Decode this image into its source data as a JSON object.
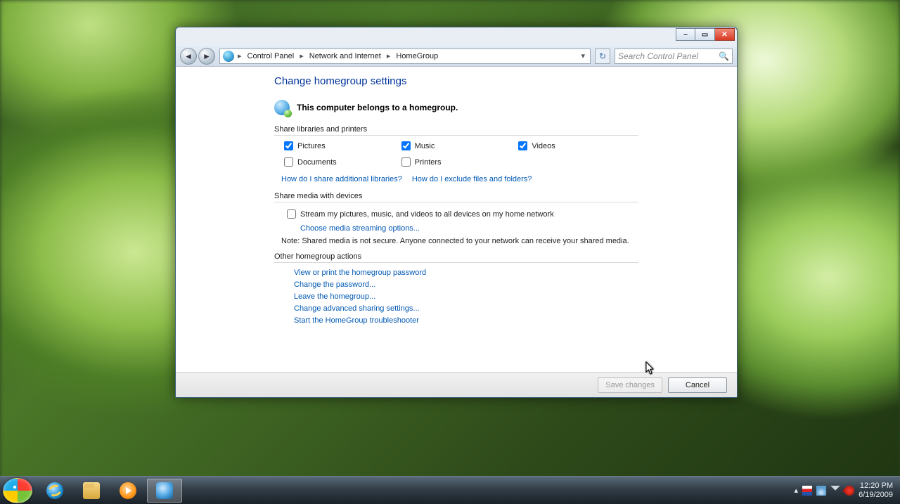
{
  "breadcrumb": {
    "root": "Control Panel",
    "mid": "Network and Internet",
    "leaf": "HomeGroup"
  },
  "search": {
    "placeholder": "Search Control Panel"
  },
  "page": {
    "title": "Change homegroup settings",
    "belongs": "This computer belongs to a homegroup."
  },
  "sections": {
    "share_lib": "Share libraries and printers",
    "share_media": "Share media with devices",
    "other_actions": "Other homegroup actions"
  },
  "libs": {
    "pictures": "Pictures",
    "music": "Music",
    "videos": "Videos",
    "documents": "Documents",
    "printers": "Printers"
  },
  "links": {
    "share_additional": "How do I share additional libraries?",
    "exclude": "How do I exclude files and folders?",
    "stream_opts": "Choose media streaming options...",
    "view_pw": "View or print the homegroup password",
    "change_pw": "Change the password...",
    "leave": "Leave the homegroup...",
    "adv_sharing": "Change advanced sharing settings...",
    "troubleshoot": "Start the HomeGroup troubleshooter"
  },
  "stream": {
    "label": "Stream my pictures, music, and videos to all devices on my home network",
    "note": "Note: Shared media is not secure. Anyone connected to your network can receive your shared media."
  },
  "buttons": {
    "save": "Save changes",
    "cancel": "Cancel"
  },
  "systray": {
    "time": "12:20 PM",
    "date": "6/19/2009"
  }
}
